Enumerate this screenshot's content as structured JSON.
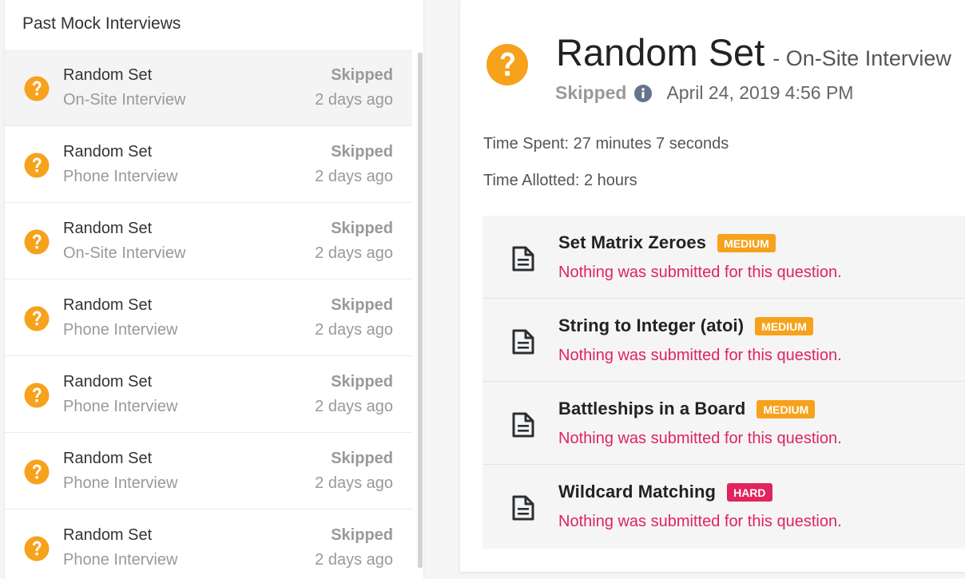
{
  "left": {
    "header": "Past Mock Interviews",
    "items": [
      {
        "title": "Random Set",
        "subtitle": "On-Site Interview",
        "status": "Skipped",
        "ago": "2 days ago",
        "active": true
      },
      {
        "title": "Random Set",
        "subtitle": "Phone Interview",
        "status": "Skipped",
        "ago": "2 days ago"
      },
      {
        "title": "Random Set",
        "subtitle": "On-Site Interview",
        "status": "Skipped",
        "ago": "2 days ago"
      },
      {
        "title": "Random Set",
        "subtitle": "Phone Interview",
        "status": "Skipped",
        "ago": "2 days ago"
      },
      {
        "title": "Random Set",
        "subtitle": "Phone Interview",
        "status": "Skipped",
        "ago": "2 days ago"
      },
      {
        "title": "Random Set",
        "subtitle": "Phone Interview",
        "status": "Skipped",
        "ago": "2 days ago"
      },
      {
        "title": "Random Set",
        "subtitle": "Phone Interview",
        "status": "Skipped",
        "ago": "2 days ago"
      }
    ]
  },
  "detail": {
    "title": "Random Set",
    "type": "- On-Site Interview",
    "status": "Skipped",
    "date": "April 24, 2019 4:56 PM",
    "time_spent": "Time Spent: 27 minutes 7 seconds",
    "time_allotted": "Time Allotted: 2 hours",
    "questions": [
      {
        "name": "Set Matrix Zeroes",
        "difficulty": "MEDIUM",
        "message": "Nothing was submitted for this question."
      },
      {
        "name": "String to Integer (atoi)",
        "difficulty": "MEDIUM",
        "message": "Nothing was submitted for this question."
      },
      {
        "name": "Battleships in a Board",
        "difficulty": "MEDIUM",
        "message": "Nothing was submitted for this question."
      },
      {
        "name": "Wildcard Matching",
        "difficulty": "HARD",
        "message": "Nothing was submitted for this question."
      }
    ]
  },
  "colors": {
    "question_icon": "#f7a21c",
    "medium_badge": "#f7a21c",
    "hard_badge": "#e0245e",
    "error_text": "#e0245e",
    "info_icon": "#64758a"
  },
  "icons": {
    "status": "question-circle-icon",
    "info": "info-circle-icon",
    "question": "document-icon"
  }
}
